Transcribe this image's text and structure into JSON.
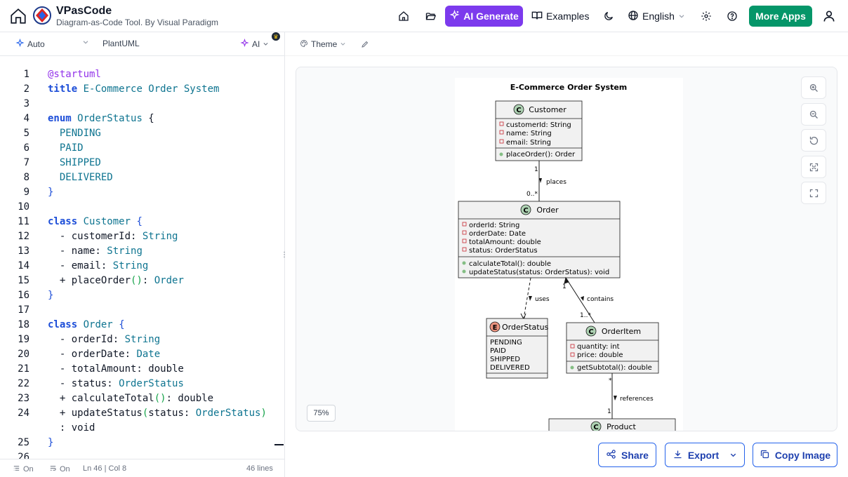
{
  "header": {
    "brand_title": "VPasCode",
    "brand_subtitle": "Diagram-as-Code Tool. By Visual Paradigm",
    "ai_generate_label": "AI Generate",
    "examples_label": "Examples",
    "language_label": "English",
    "more_apps_label": "More Apps"
  },
  "editor_toolbar": {
    "mode": "Auto",
    "language": "PlantUML",
    "ai_label": "AI"
  },
  "code_lines": [
    {
      "num": "1",
      "text": "@startuml"
    },
    {
      "num": "2",
      "text": "title E-Commerce Order System"
    },
    {
      "num": "3",
      "text": ""
    },
    {
      "num": "4",
      "text": "enum OrderStatus {"
    },
    {
      "num": "5",
      "text": "  PENDING"
    },
    {
      "num": "6",
      "text": "  PAID"
    },
    {
      "num": "7",
      "text": "  SHIPPED"
    },
    {
      "num": "8",
      "text": "  DELIVERED"
    },
    {
      "num": "9",
      "text": "}"
    },
    {
      "num": "10",
      "text": ""
    },
    {
      "num": "11",
      "text": "class Customer {"
    },
    {
      "num": "12",
      "text": "  - customerId: String"
    },
    {
      "num": "13",
      "text": "  - name: String"
    },
    {
      "num": "14",
      "text": "  - email: String"
    },
    {
      "num": "15",
      "text": "  + placeOrder(): Order"
    },
    {
      "num": "16",
      "text": "}"
    },
    {
      "num": "17",
      "text": ""
    },
    {
      "num": "18",
      "text": "class Order {"
    },
    {
      "num": "19",
      "text": "  - orderId: String"
    },
    {
      "num": "20",
      "text": "  - orderDate: Date"
    },
    {
      "num": "21",
      "text": "  - totalAmount: double"
    },
    {
      "num": "22",
      "text": "  - status: OrderStatus"
    },
    {
      "num": "23",
      "text": "  + calculateTotal(): double"
    },
    {
      "num": "24",
      "text": "  + updateStatus(status: OrderStatus)"
    },
    {
      "num": "",
      "text": "  : void"
    },
    {
      "num": "25",
      "text": "}"
    },
    {
      "num": "26",
      "text": ""
    }
  ],
  "status_bar": {
    "wrap": "On",
    "format": "On",
    "cursor": "Ln 46 | Col 8",
    "lines": "46 lines"
  },
  "preview": {
    "theme_label": "Theme",
    "zoom_level": "75%",
    "share_label": "Share",
    "export_label": "Export",
    "copy_image_label": "Copy Image"
  },
  "diagram": {
    "title": "E-Commerce Order System",
    "customer": {
      "name": "Customer",
      "attributes": [
        "customerId: String",
        "name: String",
        "email: String"
      ],
      "methods": [
        "placeOrder(): Order"
      ]
    },
    "order": {
      "name": "Order",
      "attributes": [
        "orderId: String",
        "orderDate: Date",
        "totalAmount: double",
        "status: OrderStatus"
      ],
      "methods": [
        "calculateTotal(): double",
        "updateStatus(status: OrderStatus): void"
      ]
    },
    "order_status": {
      "name": "OrderStatus",
      "values": [
        "PENDING",
        "PAID",
        "SHIPPED",
        "DELIVERED"
      ]
    },
    "order_item": {
      "name": "OrderItem",
      "attributes": [
        "quantity: int",
        "price: double"
      ],
      "methods": [
        "getSubtotal(): double"
      ]
    },
    "product": {
      "name": "Product"
    },
    "relations": {
      "places": "places",
      "places_from": "1",
      "places_to": "0..*",
      "uses": "uses",
      "contains": "contains",
      "contains_from": "1",
      "contains_to": "1..*",
      "references": "references",
      "references_from": "*",
      "references_to": "1"
    },
    "stereotype_class": "C",
    "stereotype_enum": "E"
  }
}
